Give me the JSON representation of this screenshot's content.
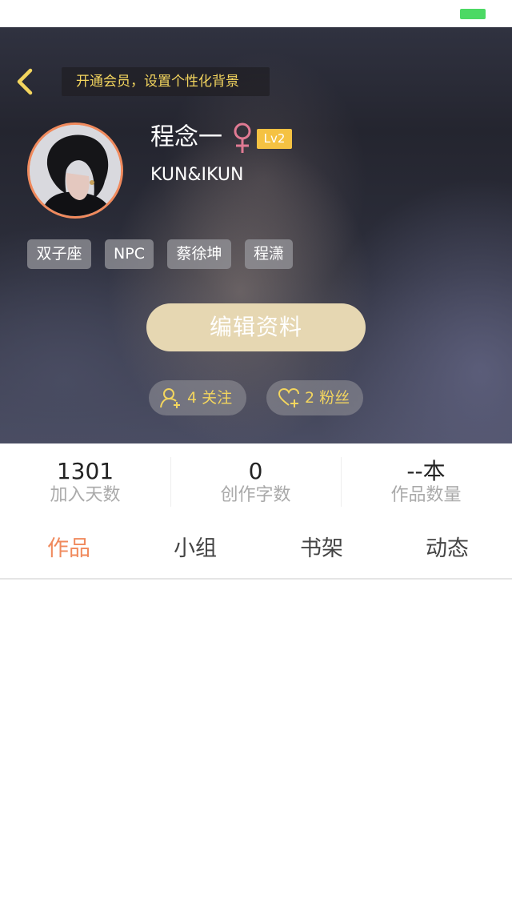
{
  "status_bar": {
    "battery_color": "#4cd964"
  },
  "header": {
    "back_icon": "chevron-left-icon",
    "vip_banner": "开通会员，设置个性化背景",
    "user": {
      "name": "程念一",
      "gender_icon": "female-icon",
      "level": "Lv2",
      "id": "KUN&IKUN"
    },
    "tags": [
      "双子座",
      "NPC",
      "蔡徐坤",
      "程潇"
    ],
    "edit_button": "编辑资料",
    "following": {
      "icon": "add-user-icon",
      "label": "4 关注"
    },
    "fans": {
      "icon": "heart-plus-icon",
      "label": "2 粉丝"
    }
  },
  "stats": [
    {
      "value": "1301",
      "label": "加入天数"
    },
    {
      "value": "0",
      "label": "创作字数"
    },
    {
      "value": "--本",
      "label": "作品数量"
    }
  ],
  "tabs": [
    {
      "label": "作品",
      "active": true
    },
    {
      "label": "小组",
      "active": false
    },
    {
      "label": "书架",
      "active": false
    },
    {
      "label": "动态",
      "active": false
    }
  ],
  "colors": {
    "accent": "#f08a5d",
    "gold": "#f3d55e",
    "level_badge": "#f5c242",
    "edit_button": "#e6d7b2"
  }
}
